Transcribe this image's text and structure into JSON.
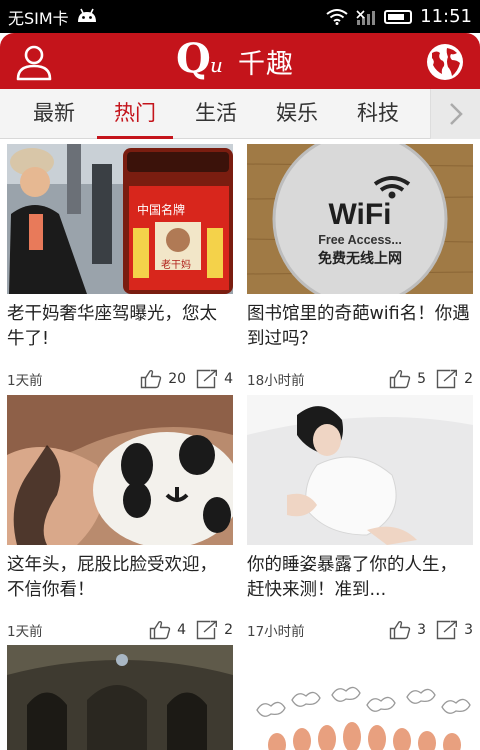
{
  "status_bar": {
    "carrier": "无SIM卡",
    "time": "11:51"
  },
  "header": {
    "logo_mark_q": "Q",
    "logo_mark_u": "u",
    "logo_text": "千趣"
  },
  "tabs": [
    {
      "label": "最新",
      "active": false
    },
    {
      "label": "热门",
      "active": true
    },
    {
      "label": "生活",
      "active": false
    },
    {
      "label": "娱乐",
      "active": false
    },
    {
      "label": "科技",
      "active": false
    }
  ],
  "articles": [
    {
      "title": "老干妈奢华座驾曝光，您太牛了!",
      "time": "1天前",
      "likes": "20",
      "shares": "4"
    },
    {
      "title": "图书馆里的奇葩wifi名！你遇到过吗？",
      "time": "18小时前",
      "likes": "5",
      "shares": "2"
    },
    {
      "title": "这年头，屁股比脸受欢迎，不信你看！",
      "time": "1天前",
      "likes": "4",
      "shares": "2"
    },
    {
      "title": "你的睡姿暴露了你的人生，赶快来测！准到...",
      "time": "17小时前",
      "likes": "3",
      "shares": "3"
    }
  ],
  "images": {
    "wifi_sign_title": "WiFi",
    "wifi_sign_sub": "Free Access...",
    "wifi_sign_cn": "免费无线上网",
    "jar_label_top": "中国名牌",
    "jar_label_name": "老干妈"
  },
  "colors": {
    "brand_red": "#c4141b",
    "tab_bg": "#f4f4f4"
  }
}
